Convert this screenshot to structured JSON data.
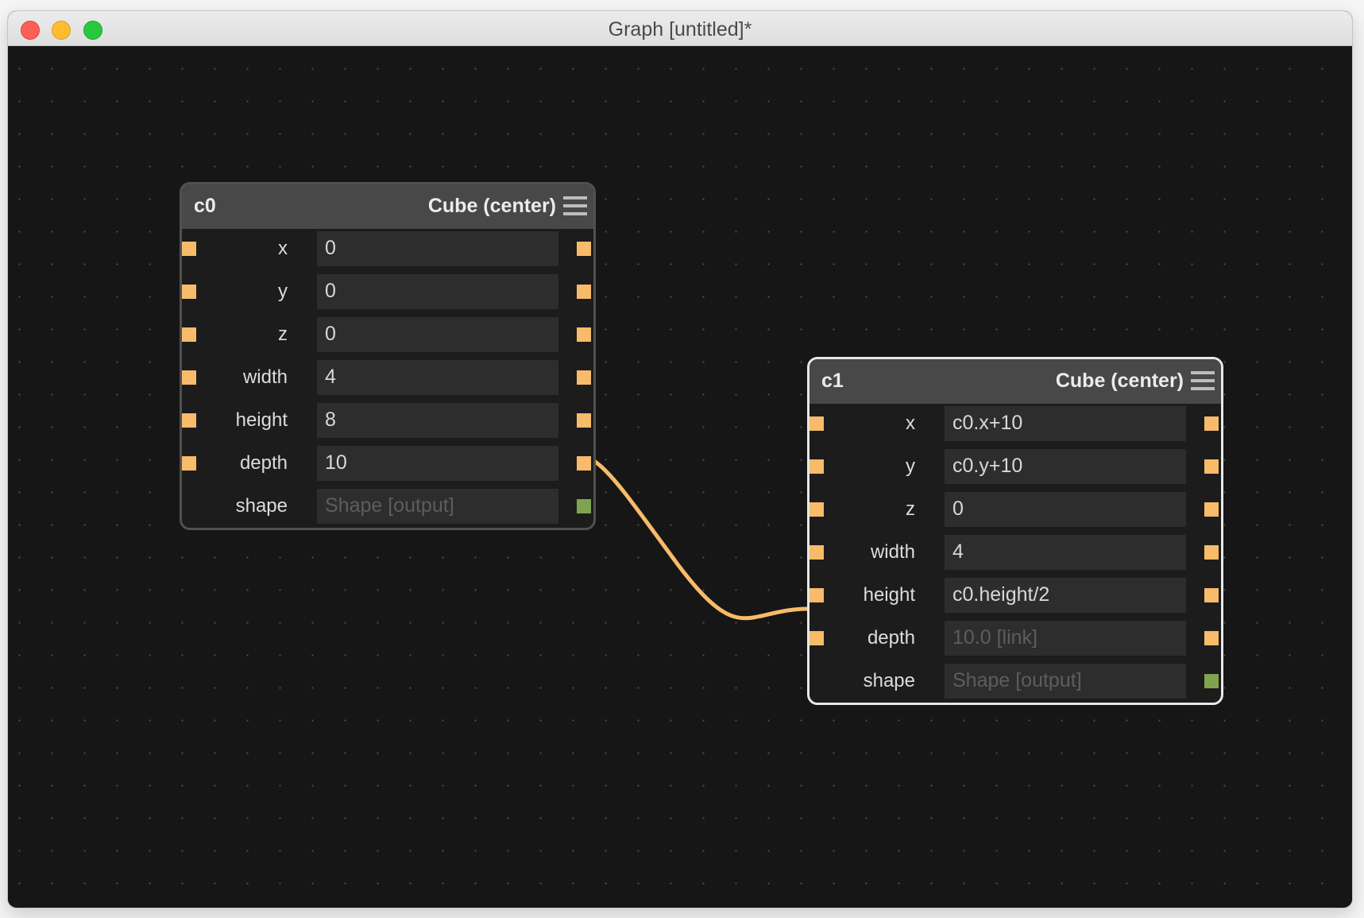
{
  "window": {
    "title": "Graph [untitled]*"
  },
  "colors": {
    "canvas": "#161616",
    "port": "#f7bb6a",
    "shape_port": "#80a350",
    "wire": "#f7bb6a"
  },
  "nodes": [
    {
      "name": "c0",
      "type": "Cube (center)",
      "selected": false,
      "rows": [
        {
          "label": "x",
          "value": "0",
          "input_port": true
        },
        {
          "label": "y",
          "value": "0",
          "input_port": true
        },
        {
          "label": "z",
          "value": "0",
          "input_port": true
        },
        {
          "label": "width",
          "value": "4",
          "input_port": true
        },
        {
          "label": "height",
          "value": "8",
          "input_port": true
        },
        {
          "label": "depth",
          "value": "10",
          "input_port": true
        },
        {
          "label": "shape",
          "value": "Shape [output]",
          "input_port": false
        }
      ]
    },
    {
      "name": "c1",
      "type": "Cube (center)",
      "selected": true,
      "rows": [
        {
          "label": "x",
          "value": "c0.x+10",
          "input_port": true
        },
        {
          "label": "y",
          "value": "c0.y+10",
          "input_port": true
        },
        {
          "label": "z",
          "value": "0",
          "input_port": true
        },
        {
          "label": "width",
          "value": "4",
          "input_port": true
        },
        {
          "label": "height",
          "value": "c0.height/2",
          "input_port": true
        },
        {
          "label": "depth",
          "value": "10.0 [link]",
          "input_port": true
        },
        {
          "label": "shape",
          "value": "Shape [output]",
          "input_port": false
        }
      ]
    }
  ],
  "connections": [
    {
      "from": "c0.depth",
      "to": "c1.depth"
    }
  ]
}
